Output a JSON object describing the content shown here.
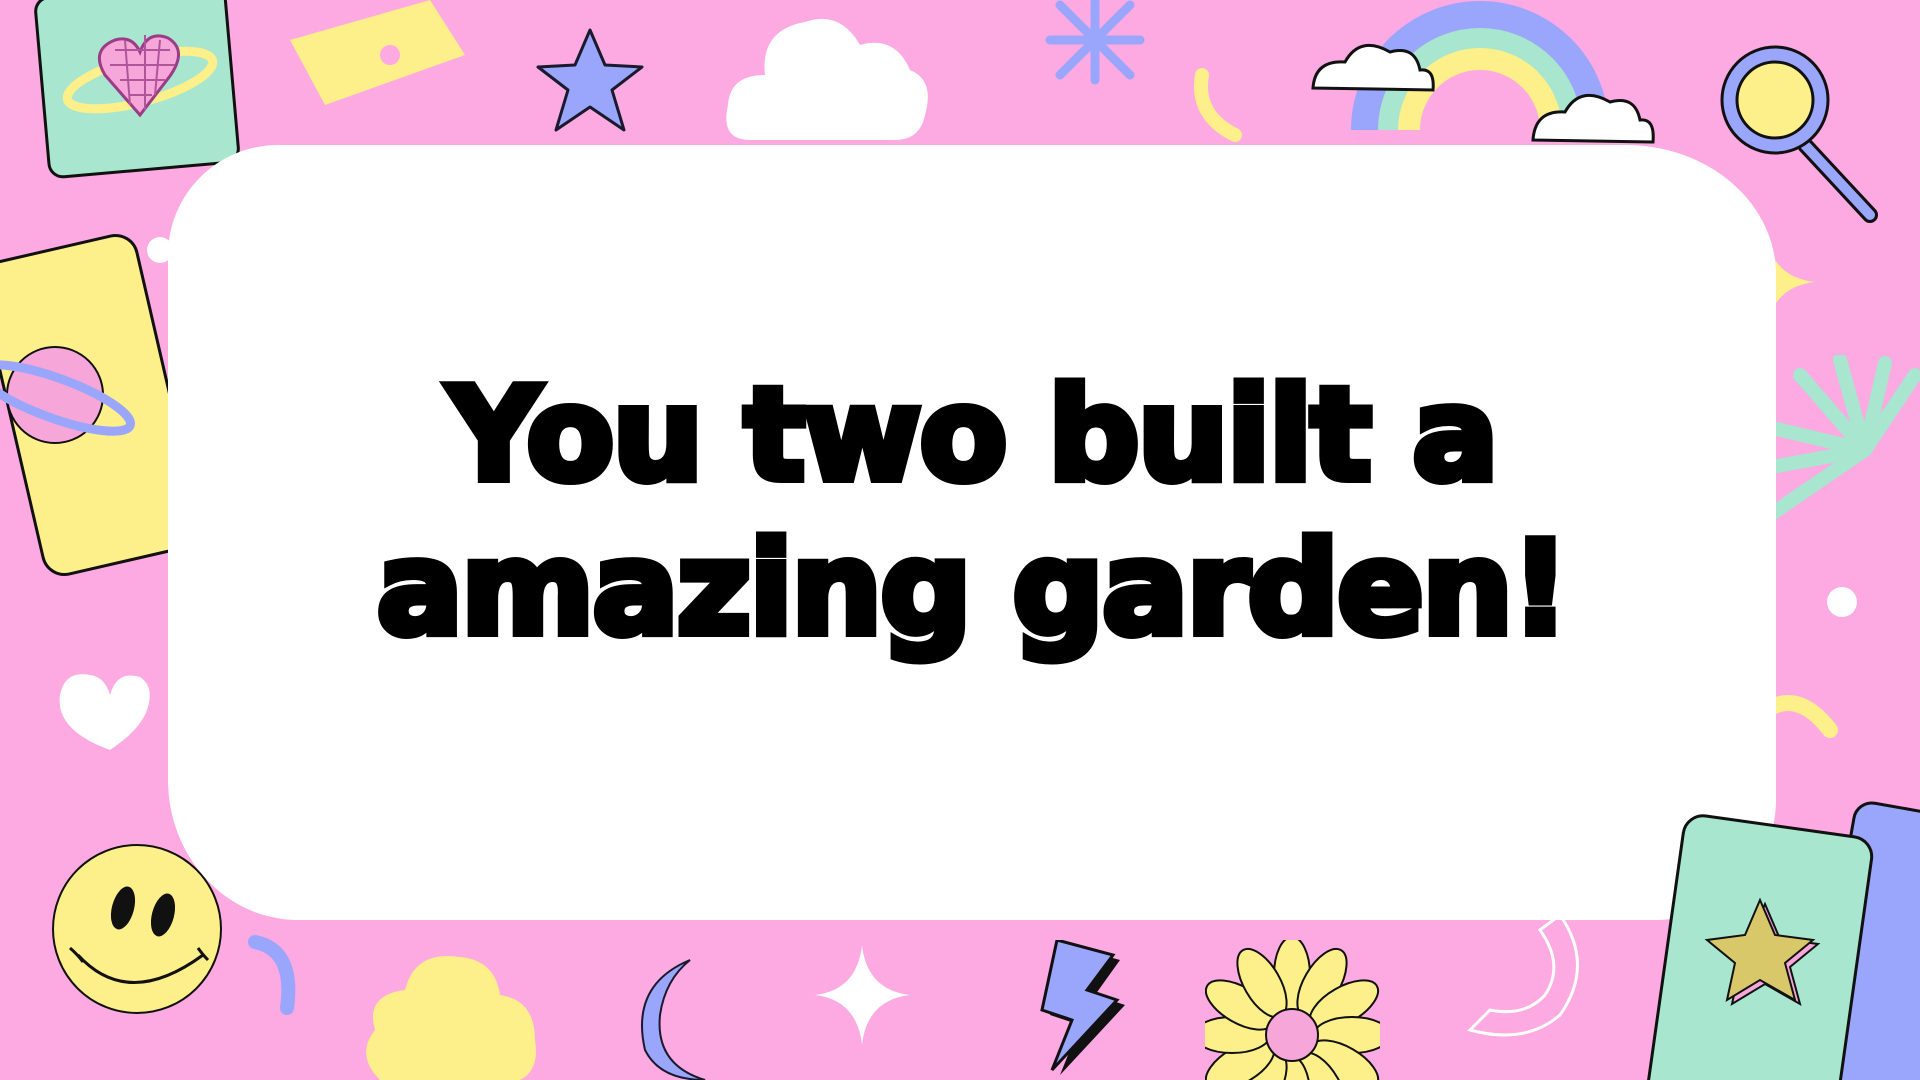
{
  "slide": {
    "headline_line1": "You two built a",
    "headline_line2": "amazing garden!"
  },
  "colors": {
    "background": "#fda9e2",
    "panel": "#ffffff",
    "text": "#000000",
    "mint": "#a8e6cf",
    "yellow": "#fdef8a",
    "periwinkle": "#9aa6fb",
    "pink": "#f6a6d8"
  },
  "decorations": [
    "heart-planet-card-icon",
    "planet-card-icon",
    "ticket-icon",
    "star-icon",
    "cloud-icon",
    "asterisk-icon",
    "rainbow-icon",
    "magnifier-icon",
    "sparkle-icon",
    "burst-icon",
    "heart-icon",
    "smiley-icon",
    "moon-icon",
    "lightning-icon",
    "flower-icon",
    "star-card-icon"
  ]
}
